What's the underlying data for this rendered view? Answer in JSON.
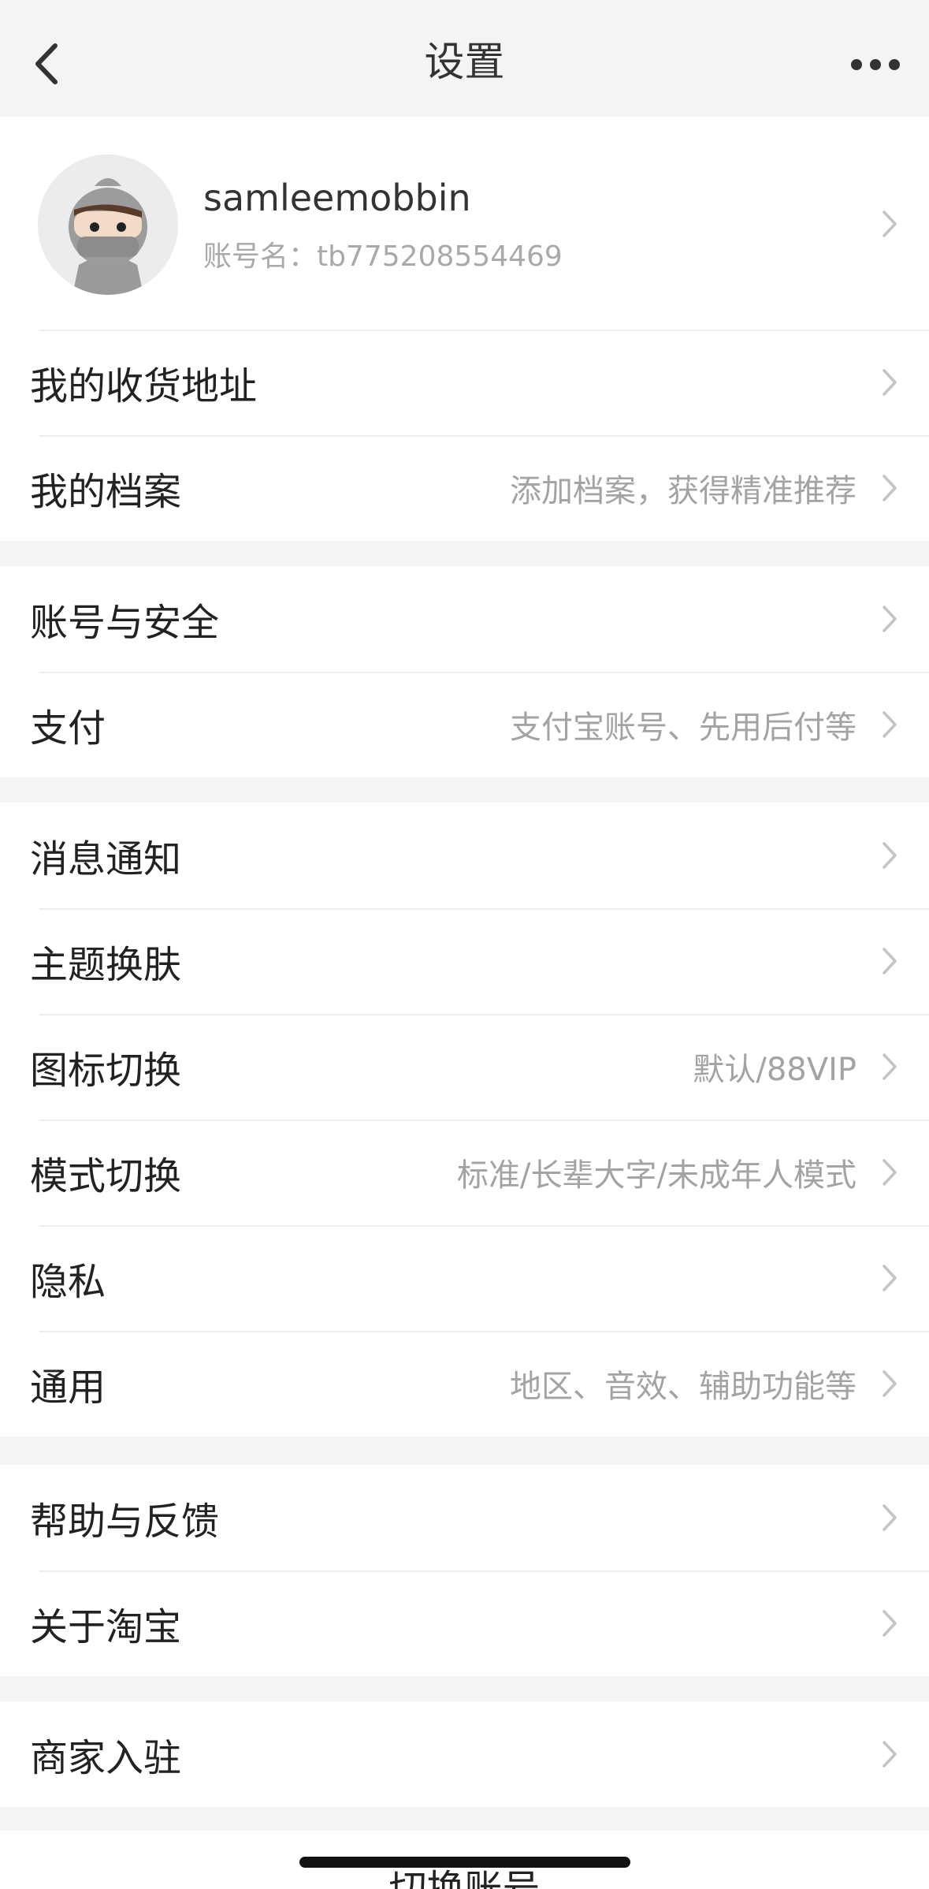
{
  "header": {
    "title": "设置",
    "back_icon": "chevron-left-icon",
    "more_icon": "more-dots-icon"
  },
  "profile": {
    "username": "samleemobbin",
    "account_label": "账号名：tb775208554469"
  },
  "groups": [
    {
      "items": [
        {
          "label": "我的收货地址",
          "value": ""
        },
        {
          "label": "我的档案",
          "value": "添加档案，获得精准推荐"
        }
      ]
    },
    {
      "items": [
        {
          "label": "账号与安全",
          "value": ""
        },
        {
          "label": "支付",
          "value": "支付宝账号、先用后付等"
        }
      ]
    },
    {
      "items": [
        {
          "label": "消息通知",
          "value": ""
        },
        {
          "label": "主题换肤",
          "value": ""
        },
        {
          "label": "图标切换",
          "value": "默认/88VIP"
        },
        {
          "label": "模式切换",
          "value": "标准/长辈大字/未成年人模式"
        },
        {
          "label": "隐私",
          "value": ""
        },
        {
          "label": "通用",
          "value": "地区、音效、辅助功能等"
        }
      ]
    },
    {
      "items": [
        {
          "label": "帮助与反馈",
          "value": ""
        },
        {
          "label": "关于淘宝",
          "value": ""
        }
      ]
    },
    {
      "items": [
        {
          "label": "商家入驻",
          "value": ""
        }
      ]
    }
  ],
  "footer": {
    "switch_account": "切换账号"
  }
}
